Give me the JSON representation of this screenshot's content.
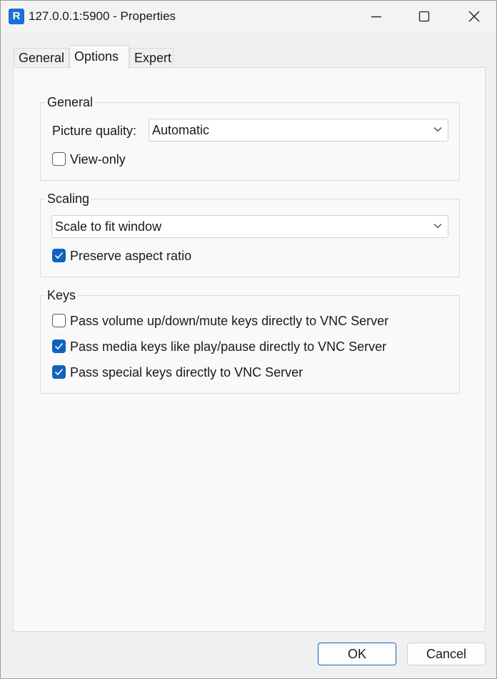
{
  "window": {
    "title": "127.0.0.1:5900 - Properties"
  },
  "titlebar": {
    "app_icon": "vnc-viewer-icon",
    "buttons": [
      "minimize-icon",
      "maximize-icon",
      "close-icon"
    ]
  },
  "tabs": [
    {
      "label": "General",
      "selected": false
    },
    {
      "label": "Options",
      "selected": true
    },
    {
      "label": "Expert",
      "selected": false
    }
  ],
  "general_group": {
    "title": "General",
    "picture_quality_label": "Picture quality:",
    "picture_quality_value": "Automatic",
    "view_only": {
      "label": "View-only",
      "checked": false
    }
  },
  "scaling_group": {
    "title": "Scaling",
    "scaling_value": "Scale to fit window",
    "preserve_aspect": {
      "label": "Preserve aspect ratio",
      "checked": true
    }
  },
  "keys_group": {
    "title": "Keys",
    "options": [
      {
        "label": "Pass volume up/down/mute keys directly to VNC Server",
        "checked": false
      },
      {
        "label": "Pass media keys like play/pause directly to VNC Server",
        "checked": true
      },
      {
        "label": "Pass special keys directly to VNC Server",
        "checked": true
      }
    ]
  },
  "footer": {
    "ok_label": "OK",
    "cancel_label": "Cancel"
  },
  "colors": {
    "accent": "#0f62c0",
    "panel": "#f9f9f9",
    "window": "#f0f0f0"
  }
}
